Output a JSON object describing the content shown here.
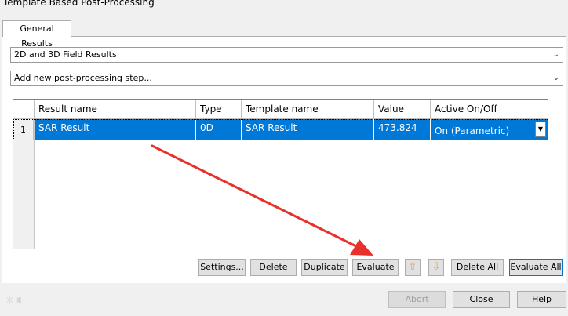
{
  "window": {
    "title": "Template Based Post-Processing"
  },
  "tabs": [
    {
      "label": "General Results"
    }
  ],
  "combos": {
    "results_type": {
      "value": "2D and 3D Field Results"
    },
    "add_step": {
      "value": "Add new post-processing step..."
    }
  },
  "table": {
    "headers": [
      "Result name",
      "Type",
      "Template name",
      "Value",
      "Active On/Off"
    ],
    "rows": [
      {
        "num": "1",
        "result_name": "SAR Result",
        "type": "0D",
        "template_name": "SAR Result",
        "value": "473.824",
        "active": "On (Parametric)"
      }
    ]
  },
  "buttons": {
    "settings": "Settings...",
    "delete": "Delete",
    "duplicate": "Duplicate",
    "evaluate": "Evaluate",
    "move_up": "⇧",
    "move_down": "⇩",
    "delete_all": "Delete All",
    "evaluate_all": "Evaluate All",
    "abort": "Abort",
    "close": "Close",
    "help": "Help"
  },
  "icons": {
    "dropdown": "chevron-down-icon",
    "up": "up-arrow-icon",
    "down": "down-arrow-icon",
    "annotation": "red-arrow-annotation"
  },
  "colors": {
    "selection": "#0078d7",
    "annotation": "#e8312a"
  }
}
